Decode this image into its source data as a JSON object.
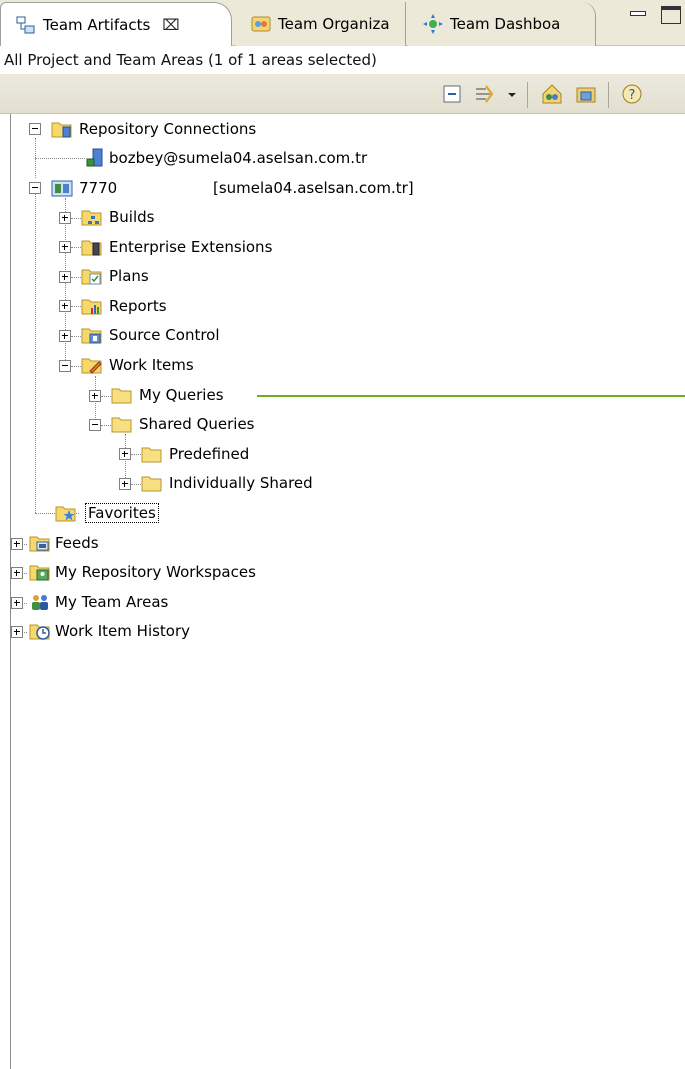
{
  "tabs": [
    {
      "label": "Team Artifacts",
      "active": true,
      "close": "⌧"
    },
    {
      "label": "Team Organiza",
      "active": false
    },
    {
      "label": "Team Dashboa",
      "active": false
    }
  ],
  "filter_text": "All Project and Team Areas (1 of 1 areas selected)",
  "toolbar": {
    "buttons": [
      "collapse-all-icon",
      "link-filter-icon",
      "view-menu-dropdown-icon",
      "team-area-icon",
      "project-area-icon",
      "help-icon"
    ]
  },
  "tree": {
    "repository_connections": "Repository Connections",
    "connection_user": "bozbey@sumela04.aselsan.com.tr",
    "project": {
      "name": "7770",
      "server": "[sumela04.aselsan.com.tr]"
    },
    "project_children": {
      "builds": "Builds",
      "enterprise_extensions": "Enterprise Extensions",
      "plans": "Plans",
      "reports": "Reports",
      "source_control": "Source Control",
      "work_items": "Work Items",
      "my_queries": "My Queries",
      "shared_queries": "Shared Queries",
      "predefined": "Predefined",
      "individually_shared": "Individually Shared"
    },
    "favorites": "Favorites",
    "feeds": "Feeds",
    "my_repository_workspaces": "My Repository Workspaces",
    "my_team_areas": "My Team Areas",
    "work_item_history": "Work Item History"
  },
  "colors": {
    "chrome": "#ece9d8",
    "folder": "#f6d86b",
    "annotation_line": "#6fae1e"
  }
}
